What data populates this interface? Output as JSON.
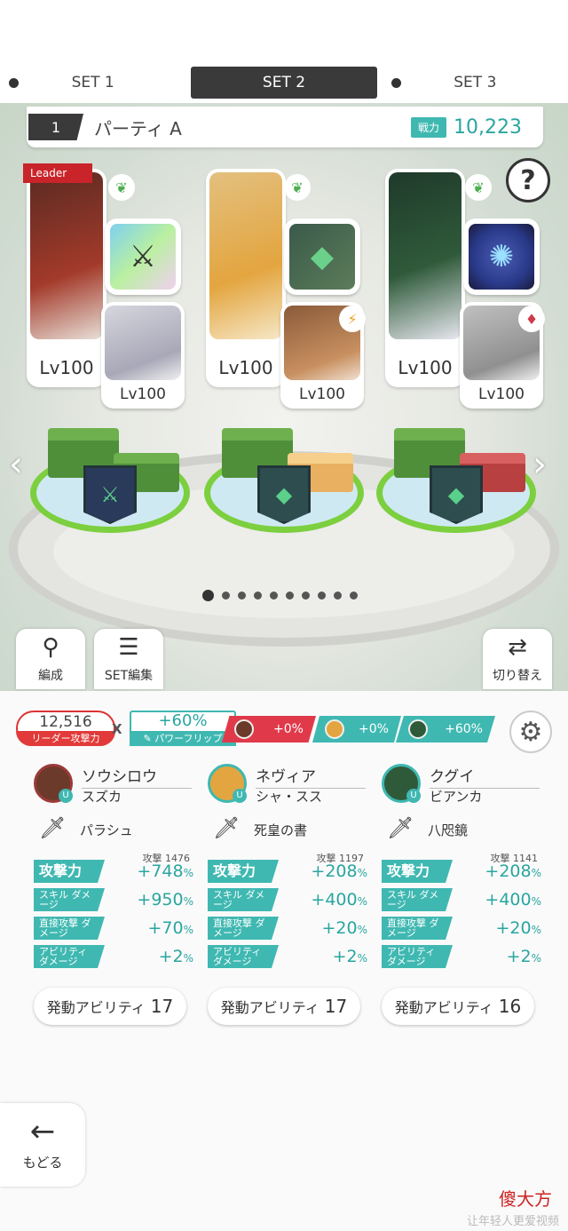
{
  "set_tabs": [
    {
      "label": "SET 1",
      "active": false
    },
    {
      "label": "SET 2",
      "active": true
    },
    {
      "label": "SET 3",
      "active": false
    }
  ],
  "party": {
    "number": "1",
    "name": "パーティ A",
    "power_label": "戦力",
    "power_value": "10,223"
  },
  "help_label": "?",
  "leader_tag": "Leader",
  "slots": [
    {
      "main_lv": "Lv100",
      "sub_lv": "Lv100",
      "element_icon": "leaf-icon",
      "sub_element_icon": "leaf-icon",
      "weapon_icon": "axe-icon",
      "weapon_colors": [
        "#7fd0f0",
        "#b9f0a0"
      ],
      "portrait_color": "#5a2a22",
      "sub_color": "#d6d6de"
    },
    {
      "main_lv": "Lv100",
      "sub_lv": "Lv100",
      "element_icon": "leaf-icon",
      "sub_element_icon": "lightning-icon",
      "weapon_icon": "book-icon",
      "weapon_colors": [
        "#3b5a4a",
        "#5c7c5a"
      ],
      "portrait_color": "#e3a53f",
      "sub_color": "#8a5a3a"
    },
    {
      "main_lv": "Lv100",
      "sub_lv": "Lv100",
      "element_icon": "leaf-icon",
      "sub_element_icon": "diamond-icon",
      "weapon_icon": "mirror-icon",
      "weapon_colors": [
        "#2a3a8a",
        "#4a5ab0"
      ],
      "portrait_color": "#2f5a3a",
      "sub_color": "#b0b0b0"
    }
  ],
  "tools": {
    "formation": "編成",
    "set_edit": "SET編集",
    "switch": "切り替え"
  },
  "summary": {
    "leader_value": "12,516",
    "leader_label": "リーダー攻撃力",
    "x": "X",
    "flip_value": "+60%",
    "flip_label": "パワーフリップ",
    "bonuses": [
      {
        "value": "+0%",
        "color": "#e03a4a"
      },
      {
        "value": "+0%",
        "color": "#3fb8b1"
      },
      {
        "value": "+60%",
        "color": "#3fb8b1"
      }
    ]
  },
  "columns": [
    {
      "name": "ソウシロウ",
      "sub": "スズカ",
      "weapon": "パラシュ",
      "avatar_color": "#6b3a2a",
      "avatar_border": "#9b3a3a",
      "atk_label": "攻撃力",
      "atk_base_label": "攻撃",
      "atk_base": "1476",
      "atk": "+748",
      "skill_label": "スキル ダメージ",
      "skill": "+950",
      "direct_label": "直接攻撃 ダメージ",
      "direct": "+70",
      "ability_dmg_label": "アビリティ ダメージ",
      "ability_dmg": "+2",
      "ability_btn": "発動アビリティ",
      "ability_count": "17"
    },
    {
      "name": "ネヴィア",
      "sub": "シャ・スス",
      "weapon": "死皇の書",
      "avatar_color": "#e3a53f",
      "avatar_border": "#3fb8b1",
      "atk_label": "攻撃力",
      "atk_base_label": "攻撃",
      "atk_base": "1197",
      "atk": "+208",
      "skill_label": "スキル ダメージ",
      "skill": "+400",
      "direct_label": "直接攻撃 ダメージ",
      "direct": "+20",
      "ability_dmg_label": "アビリティ ダメージ",
      "ability_dmg": "+2",
      "ability_btn": "発動アビリティ",
      "ability_count": "17"
    },
    {
      "name": "クグイ",
      "sub": "ビアンカ",
      "weapon": "八咫鏡",
      "avatar_color": "#2f5a3a",
      "avatar_border": "#3fb8b1",
      "atk_label": "攻撃力",
      "atk_base_label": "攻撃",
      "atk_base": "1141",
      "atk": "+208",
      "skill_label": "スキル ダメージ",
      "skill": "+400",
      "direct_label": "直接攻撃 ダメージ",
      "direct": "+20",
      "ability_dmg_label": "アビリティ ダメージ",
      "ability_dmg": "+2",
      "ability_btn": "発動アビリティ",
      "ability_count": "16"
    }
  ],
  "pct": "%",
  "back_label": "もどる",
  "watermark": "傻大方",
  "watermark_sub": "让年轻人更爱视频"
}
